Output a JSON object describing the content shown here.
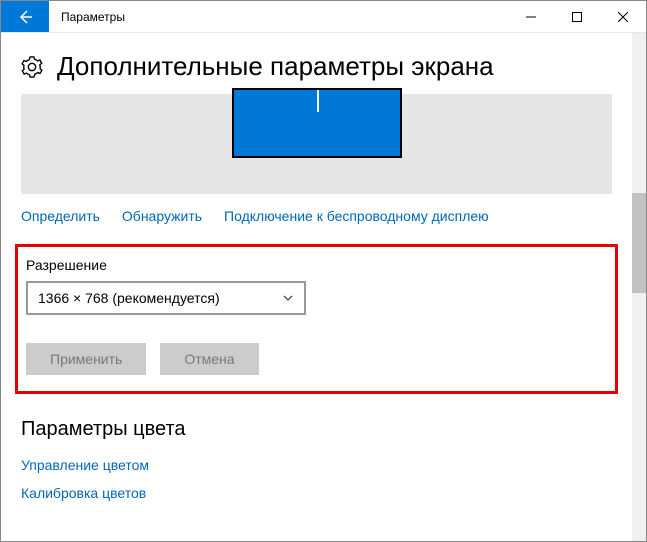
{
  "window": {
    "title": "Параметры"
  },
  "page": {
    "title": "Дополнительные параметры экрана"
  },
  "links": {
    "identify": "Определить",
    "detect": "Обнаружить",
    "wireless": "Подключение к беспроводному дисплею"
  },
  "resolution": {
    "label": "Разрешение",
    "value": "1366 × 768 (рекомендуется)",
    "apply": "Применить",
    "cancel": "Отмена"
  },
  "color": {
    "section_title": "Параметры цвета",
    "management": "Управление цветом",
    "calibration": "Калибровка цветов"
  }
}
